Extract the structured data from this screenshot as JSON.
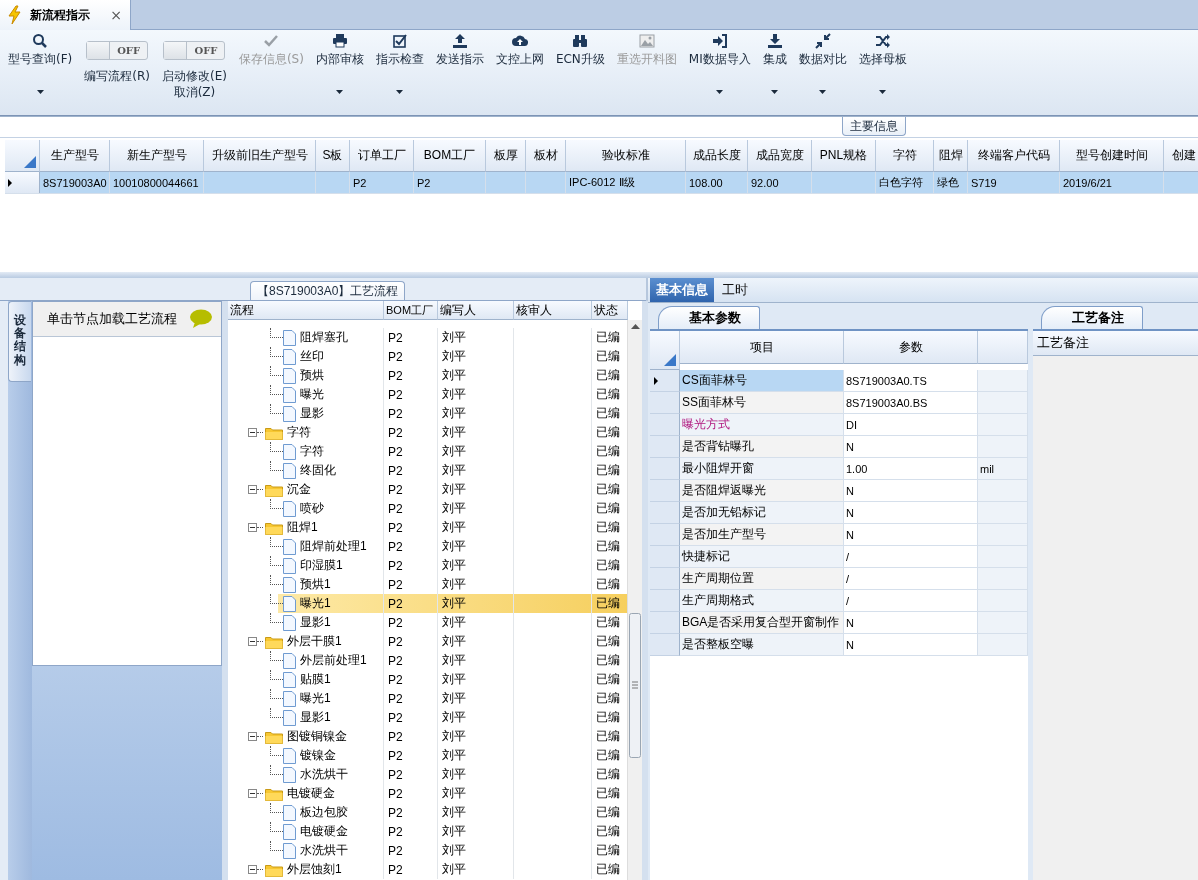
{
  "tab": {
    "title": "新流程指示",
    "close": "×"
  },
  "ribbon": {
    "buttons": [
      {
        "kind": "button",
        "label": "型号查询(F)",
        "dropdown": true,
        "disabled": false
      },
      {
        "kind": "toggle",
        "label": "编写流程(R)",
        "switch_text": "OFF",
        "on": false
      },
      {
        "kind": "toggle",
        "label": "启动修改(E)",
        "label2": "取消(Z)",
        "switch_text": "OFF",
        "on": false
      },
      {
        "kind": "button",
        "label": "保存信息(S)",
        "dropdown": false,
        "disabled": true
      },
      {
        "kind": "button",
        "label": "内部审核",
        "dropdown": true,
        "disabled": false
      },
      {
        "kind": "button",
        "label": "指示检查",
        "dropdown": true,
        "disabled": false
      },
      {
        "kind": "button",
        "label": "发送指示",
        "dropdown": false,
        "disabled": false
      },
      {
        "kind": "button",
        "label": "文控上网",
        "dropdown": false,
        "disabled": false
      },
      {
        "kind": "button",
        "label": "ECN升级",
        "dropdown": false,
        "disabled": false
      },
      {
        "kind": "button",
        "label": "重选开料图",
        "dropdown": false,
        "disabled": true
      },
      {
        "kind": "button",
        "label": "MI数据导入",
        "dropdown": true,
        "disabled": false
      },
      {
        "kind": "button",
        "label": "集成",
        "dropdown": true,
        "disabled": false
      },
      {
        "kind": "button",
        "label": "数据对比",
        "dropdown": true,
        "disabled": false
      },
      {
        "kind": "button",
        "label": "选择母板",
        "dropdown": true,
        "disabled": false
      }
    ]
  },
  "main_info": {
    "title": "主要信息",
    "columns": [
      "生产型号",
      "新生产型号",
      "升级前旧生产型号",
      "S板",
      "订单工厂",
      "BOM工厂",
      "板厚",
      "板材",
      "验收标准",
      "成品长度",
      "成品宽度",
      "PNL规格",
      "字符",
      "阻焊",
      "终端客户代码",
      "型号创建时间",
      "创建"
    ],
    "rows": [
      {
        "selected": true,
        "cells": [
          "8S719003A0",
          "10010800044661",
          null,
          null,
          "P2",
          "P2",
          null,
          null,
          "IPC-6012 Ⅱ级",
          "108.00",
          "92.00",
          null,
          "白色字符",
          "绿色",
          "S719",
          "2019/6/21",
          null
        ]
      }
    ]
  },
  "flow": {
    "title": "【8S719003A0】工艺流程",
    "side_tab": "设备结构",
    "hint": "单击节点加载工艺流程",
    "columns": [
      "流程",
      "BOM工厂",
      "编写人",
      "核审人",
      "状态"
    ],
    "tree": [
      {
        "children": [
          {
            "label": "阻焊塞孔",
            "bom": "P2",
            "author": "刘平",
            "status": "已编",
            "selected": false
          },
          {
            "label": "丝印",
            "bom": "P2",
            "author": "刘平",
            "status": "已编",
            "selected": false
          },
          {
            "label": "预烘",
            "bom": "P2",
            "author": "刘平",
            "status": "已编",
            "selected": false
          },
          {
            "label": "曝光",
            "bom": "P2",
            "author": "刘平",
            "status": "已编",
            "selected": false
          },
          {
            "label": "显影",
            "bom": "P2",
            "author": "刘平",
            "status": "已编",
            "selected": false
          }
        ]
      },
      {
        "label": "字符",
        "bom": "P2",
        "author": "刘平",
        "status": "已编",
        "selected": false,
        "expanded": true,
        "children": [
          {
            "label": "字符",
            "bom": "P2",
            "author": "刘平",
            "status": "已编",
            "selected": false
          },
          {
            "label": "终固化",
            "bom": "P2",
            "author": "刘平",
            "status": "已编",
            "selected": false
          }
        ]
      },
      {
        "label": "沉金",
        "bom": "P2",
        "author": "刘平",
        "status": "已编",
        "selected": false,
        "expanded": true,
        "children": [
          {
            "label": "喷砂",
            "bom": "P2",
            "author": "刘平",
            "status": "已编",
            "selected": false
          }
        ]
      },
      {
        "label": "阻焊1",
        "bom": "P2",
        "author": "刘平",
        "status": "已编",
        "selected": false,
        "expanded": true,
        "children": [
          {
            "label": "阻焊前处理1",
            "bom": "P2",
            "author": "刘平",
            "status": "已编",
            "selected": false
          },
          {
            "label": "印湿膜1",
            "bom": "P2",
            "author": "刘平",
            "status": "已编",
            "selected": false
          },
          {
            "label": "预烘1",
            "bom": "P2",
            "author": "刘平",
            "status": "已编",
            "selected": false
          },
          {
            "label": "曝光1",
            "bom": "P2",
            "author": "刘平",
            "status": "已编",
            "selected": true
          },
          {
            "label": "显影1",
            "bom": "P2",
            "author": "刘平",
            "status": "已编",
            "selected": false
          }
        ]
      },
      {
        "label": "外层干膜1",
        "bom": "P2",
        "author": "刘平",
        "status": "已编",
        "selected": false,
        "expanded": true,
        "children": [
          {
            "label": "外层前处理1",
            "bom": "P2",
            "author": "刘平",
            "status": "已编",
            "selected": false
          },
          {
            "label": "贴膜1",
            "bom": "P2",
            "author": "刘平",
            "status": "已编",
            "selected": false
          },
          {
            "label": "曝光1",
            "bom": "P2",
            "author": "刘平",
            "status": "已编",
            "selected": false
          },
          {
            "label": "显影1",
            "bom": "P2",
            "author": "刘平",
            "status": "已编",
            "selected": false
          }
        ]
      },
      {
        "label": "图镀铜镍金",
        "bom": "P2",
        "author": "刘平",
        "status": "已编",
        "selected": false,
        "expanded": true,
        "children": [
          {
            "label": "镀镍金",
            "bom": "P2",
            "author": "刘平",
            "status": "已编",
            "selected": false
          },
          {
            "label": "水洗烘干",
            "bom": "P2",
            "author": "刘平",
            "status": "已编",
            "selected": false
          }
        ]
      },
      {
        "label": "电镀硬金",
        "bom": "P2",
        "author": "刘平",
        "status": "已编",
        "selected": false,
        "expanded": true,
        "children": [
          {
            "label": "板边包胶",
            "bom": "P2",
            "author": "刘平",
            "status": "已编",
            "selected": false
          },
          {
            "label": "电镀硬金",
            "bom": "P2",
            "author": "刘平",
            "status": "已编",
            "selected": false
          },
          {
            "label": "水洗烘干",
            "bom": "P2",
            "author": "刘平",
            "status": "已编",
            "selected": false
          }
        ]
      },
      {
        "label": "外层蚀刻1",
        "bom": "P2",
        "author": "刘平",
        "status": "已编",
        "selected": false,
        "expanded": true
      }
    ]
  },
  "detail": {
    "tabs": [
      {
        "label": "基本信息",
        "selected": true
      },
      {
        "label": "工时",
        "selected": false
      }
    ],
    "params": {
      "tab": "基本参数",
      "columns": [
        "项目",
        "参数"
      ],
      "rows": [
        {
          "item": "CS面菲林号",
          "value": "8S719003A0.TS",
          "selected": true,
          "highlighted": false
        },
        {
          "item": "SS面菲林号",
          "value": "8S719003A0.BS",
          "selected": false,
          "highlighted": false
        },
        {
          "item": "曝光方式",
          "value": "DI",
          "selected": false,
          "highlighted": true
        },
        {
          "item": "是否背钻曝孔",
          "value": "N",
          "selected": false,
          "highlighted": false
        },
        {
          "item": "最小阻焊开窗",
          "value": "1.00",
          "unit": "mil",
          "selected": false,
          "highlighted": false
        },
        {
          "item": "是否阻焊返曝光",
          "value": "N",
          "selected": false,
          "highlighted": false
        },
        {
          "item": "是否加无铅标记",
          "value": "N",
          "selected": false,
          "highlighted": false
        },
        {
          "item": "是否加生产型号",
          "value": "N",
          "selected": false,
          "highlighted": false
        },
        {
          "item": "快捷标记",
          "value": "/",
          "selected": false,
          "highlighted": false
        },
        {
          "item": "生产周期位置",
          "value": "/",
          "selected": false,
          "highlighted": false
        },
        {
          "item": "生产周期格式",
          "value": "/",
          "selected": false,
          "highlighted": false
        },
        {
          "item": "BGA是否采用复合型开窗制作",
          "value": "N",
          "selected": false,
          "highlighted": false
        },
        {
          "item": "是否整板空曝",
          "value": "N",
          "selected": false,
          "highlighted": false
        }
      ]
    },
    "notes": {
      "tab": "工艺备注",
      "header": "工艺备注"
    }
  }
}
